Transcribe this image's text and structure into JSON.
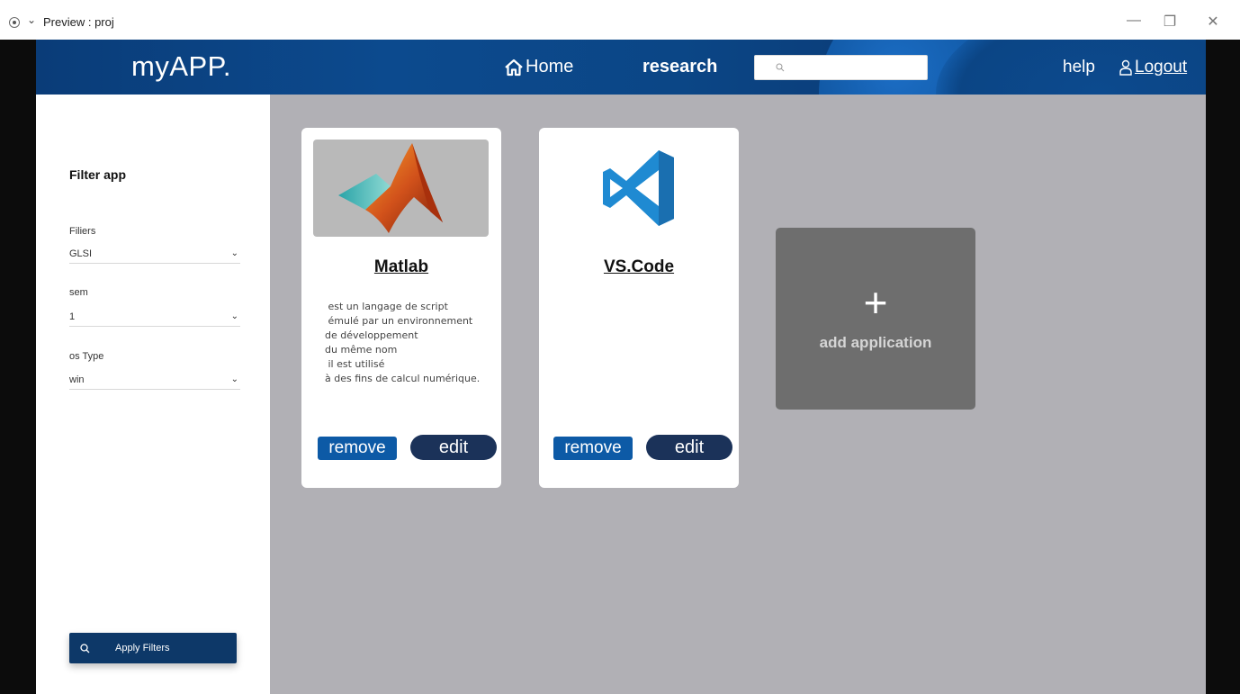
{
  "window": {
    "title": "Preview : proj",
    "chevron": "⌄",
    "controls": {
      "minimize": "—",
      "restore": "❐",
      "close": "✕"
    }
  },
  "header": {
    "brand": "myAPP.",
    "nav": {
      "home": "Home",
      "research": "research",
      "help": "help",
      "logout": "Logout"
    },
    "search": {
      "value": "",
      "placeholder": ""
    }
  },
  "sidebar": {
    "title": "Filter app",
    "filters": [
      {
        "label": "Filiers",
        "value": "GLSI"
      },
      {
        "label": "sem",
        "value": "1"
      },
      {
        "label": "os Type",
        "value": "win"
      }
    ],
    "apply_label": "Apply Filters"
  },
  "cards": [
    {
      "name": "Matlab",
      "description": " est un langage de script\n émulé par un environnement\nde développement\ndu même nom\n il est utilisé\nà des fins de calcul numérique.",
      "remove_label": "remove",
      "edit_label": "edit"
    },
    {
      "name": "VS.Code",
      "description": "",
      "remove_label": "remove",
      "edit_label": "edit"
    }
  ],
  "add_card": {
    "plus": "+",
    "label": "add application"
  },
  "colors": {
    "header": "#0b4686",
    "sidebar": "#ffffff",
    "content_bg": "#b1b0b5",
    "remove_button": "#0d5aa6",
    "edit_button": "#1b3259",
    "apply_button": "#0d3868",
    "add_card": "#6e6e6e",
    "vscode_blue": "#1f8ad2"
  }
}
